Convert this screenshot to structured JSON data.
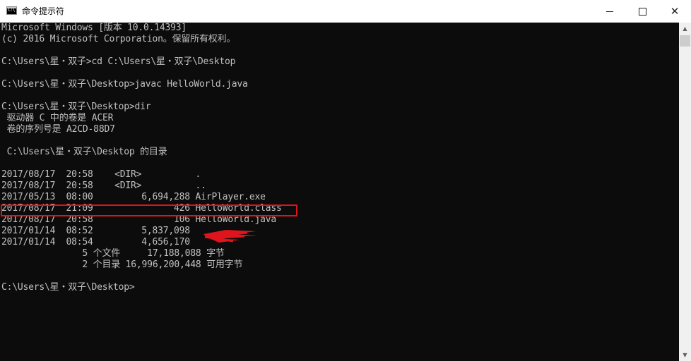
{
  "window": {
    "title": "命令提示符",
    "icon": "cmd-icon",
    "icon_text": "C:\\",
    "controls": {
      "minimize": "minimize-icon",
      "maximize": "maximize-icon",
      "close": "close-icon"
    }
  },
  "console": {
    "lines": [
      "Microsoft Windows [版本 10.0.14393]",
      "(c) 2016 Microsoft Corporation。保留所有权利。",
      "",
      "C:\\Users\\星・双子>cd C:\\Users\\星・双子\\Desktop",
      "",
      "C:\\Users\\星・双子\\Desktop>javac HelloWorld.java",
      "",
      "C:\\Users\\星・双子\\Desktop>dir",
      " 驱动器 C 中的卷是 ACER",
      " 卷的序列号是 A2CD-88D7",
      "",
      " C:\\Users\\星・双子\\Desktop 的目录",
      "",
      "2017/08/17  20:58    <DIR>          .",
      "2017/08/17  20:58    <DIR>          ..",
      "2017/05/13  08:00         6,694,288 AirPlayer.exe",
      "2017/08/17  21:09               426 HelloWorld.class",
      "2017/08/17  20:58               106 HelloWorld.java",
      "2017/01/14  08:52         5,837,098",
      "2017/01/14  08:54         4,656,170",
      "               5 个文件     17,188,088 字节",
      "               2 个目录 16,996,200,448 可用字节",
      "",
      "C:\\Users\\星・双子\\Desktop>"
    ],
    "colors": {
      "background": "#0c0c0c",
      "text": "#c0c0c0",
      "highlight_border": "#e0141c",
      "redaction": "#e0141c"
    }
  },
  "annotations": {
    "highlighted_entry": "HelloWorld.class"
  }
}
